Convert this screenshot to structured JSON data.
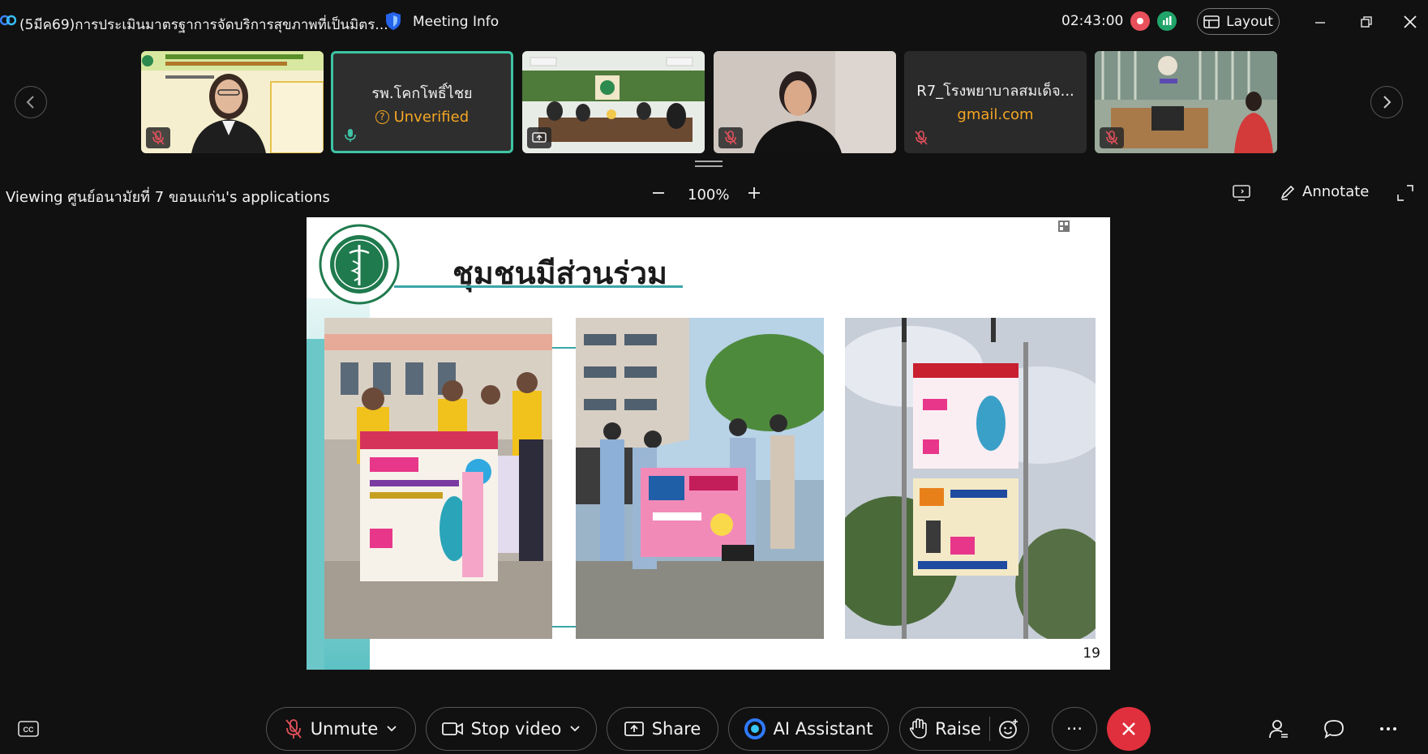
{
  "titlebar": {
    "meeting_title": "(5มีค69)การประเมินมาตรฐาการจัดบริการสุขภาพที่เป็นมิตร...",
    "meeting_info_label": "Meeting Info",
    "timer": "02:43:00",
    "layout_label": "Layout"
  },
  "participants": [
    {
      "name": "",
      "sub": "",
      "muted": true,
      "type": "video"
    },
    {
      "name": "รพ.โคกโพธิ์ไชย",
      "sub": "Unverified",
      "muted": false,
      "type": "name",
      "active": true
    },
    {
      "name": "",
      "sub": "",
      "muted": false,
      "type": "video-share"
    },
    {
      "name": "",
      "sub": "",
      "muted": true,
      "type": "video"
    },
    {
      "name": "R7_โรงพยาบาลสมเด็จ...",
      "sub": "gmail.com",
      "muted": true,
      "type": "name"
    },
    {
      "name": "",
      "sub": "",
      "muted": true,
      "type": "video"
    }
  ],
  "viewing": {
    "label": "Viewing ศูนย์อนามัยที่ 7 ขอนแก่น's applications",
    "zoom": "100%",
    "annotate_label": "Annotate"
  },
  "slide": {
    "title": "ชุมชนมีส่วนร่วม",
    "page_number": "19"
  },
  "toolbar": {
    "unmute_label": "Unmute",
    "stop_video_label": "Stop video",
    "share_label": "Share",
    "ai_assistant_label": "AI Assistant",
    "raise_label": "Raise",
    "more_label": "···"
  },
  "colors": {
    "accent_teal": "#3ec4a4",
    "end_red": "#e0303d",
    "unverified_orange": "#f5a623",
    "slide_teal": "#3aa6a8"
  }
}
